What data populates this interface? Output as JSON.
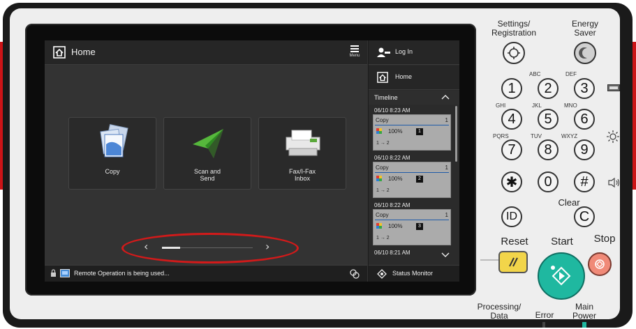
{
  "screen": {
    "header": {
      "title": "Home",
      "menu_label": "Menu"
    },
    "tiles": [
      {
        "label": "Copy"
      },
      {
        "label": "Scan and\nSend"
      },
      {
        "label": "Fax/I-Fax\nInbox"
      }
    ],
    "pager": {
      "prev": "‹",
      "next": "›",
      "page_fraction": 0.2
    },
    "status_message": "Remote Operation is being used...",
    "right_column": {
      "login_label": "Log In",
      "home_label": "Home",
      "timeline_label": "Timeline",
      "entries": [
        {
          "time": "06/10 8:23 AM",
          "job": "Copy",
          "count": "1",
          "zoom": "100%",
          "badge": "1",
          "sides": "1 → 2"
        },
        {
          "time": "06/10 8:22 AM",
          "job": "Copy",
          "count": "1",
          "zoom": "100%",
          "badge": "2",
          "sides": "1 → 2"
        },
        {
          "time": "06/10 8:22 AM",
          "job": "Copy",
          "count": "1",
          "zoom": "100%",
          "badge": "3",
          "sides": "1 → 2"
        },
        {
          "time": "06/10 8:21 AM"
        }
      ],
      "status_monitor_label": "Status Monitor"
    }
  },
  "keypad": {
    "settings_label": "Settings/\nRegistration",
    "energy_label": "Energy\nSaver",
    "keys": [
      {
        "digit": "1",
        "sub": ""
      },
      {
        "digit": "2",
        "sub": "ABC"
      },
      {
        "digit": "3",
        "sub": "DEF"
      },
      {
        "digit": "4",
        "sub": "GHI"
      },
      {
        "digit": "5",
        "sub": "JKL"
      },
      {
        "digit": "6",
        "sub": "MNO"
      },
      {
        "digit": "7",
        "sub": "PQRS"
      },
      {
        "digit": "8",
        "sub": "TUV"
      },
      {
        "digit": "9",
        "sub": "WXYZ"
      },
      {
        "digit": "✱",
        "sub": ""
      },
      {
        "digit": "0",
        "sub": ""
      },
      {
        "digit": "#",
        "sub": ""
      }
    ],
    "id_label": "ID",
    "clear_label": "Clear",
    "clear_key": "C",
    "reset_label": "Reset",
    "start_label": "Start",
    "stop_label": "Stop",
    "processing_label": "Processing/\nData",
    "error_label": "Error",
    "main_power_label": "Main\nPower"
  },
  "colors": {
    "brand_red": "#cc1417",
    "reset_yellow": "#f2d54a",
    "start_teal": "#1fb8a0",
    "stop_coral": "#f08a78",
    "highlight_ellipse": "#d21a1a"
  },
  "icons": [
    "home-icon",
    "menu-icon",
    "login-icon",
    "timeline-up-icon",
    "timeline-down-icon",
    "status-monitor-icon",
    "lock-icon",
    "remote-icon",
    "settings-icon",
    "energy-saver-icon",
    "brightness-icon",
    "volume-icon",
    "counter-icon"
  ]
}
